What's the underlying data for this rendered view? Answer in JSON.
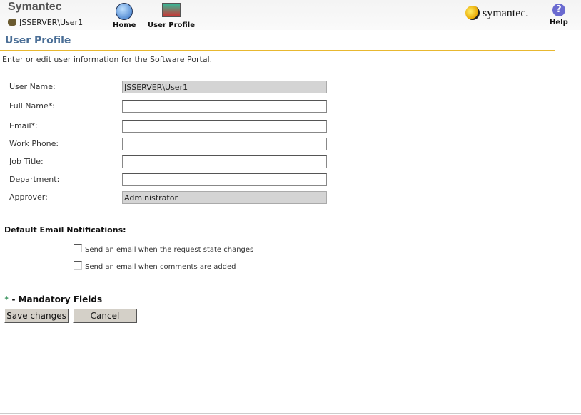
{
  "header": {
    "brand": "Symantec",
    "user": "JSSERVER\\User1",
    "nav": [
      {
        "label": "Home",
        "icon": "home-icon"
      },
      {
        "label": "User Profile",
        "icon": "user-profile-icon"
      }
    ],
    "logo_text": "symantec.",
    "help_label": "Help"
  },
  "page": {
    "title": "User Profile",
    "intro": "Enter or edit user information for the Software Portal."
  },
  "form": {
    "user_name": {
      "label": "User Name:",
      "value": "JSSERVER\\User1"
    },
    "full_name": {
      "label": "Full Name*:",
      "value": ""
    },
    "email": {
      "label": "Email*:",
      "value": ""
    },
    "work_phone": {
      "label": "Work Phone:",
      "value": ""
    },
    "job_title": {
      "label": "Job Title:",
      "value": ""
    },
    "department": {
      "label": "Department:",
      "value": ""
    },
    "approver": {
      "label": "Approver:",
      "value": "Administrator"
    }
  },
  "notifications": {
    "title": "Default Email Notifications:",
    "options": [
      {
        "label": "Send an email when the request state changes",
        "checked": false
      },
      {
        "label": "Send an email when comments are added",
        "checked": false
      }
    ]
  },
  "mandatory": {
    "star": "*",
    "text": " - Mandatory Fields"
  },
  "buttons": {
    "save": "Save changes",
    "cancel": "Cancel"
  }
}
